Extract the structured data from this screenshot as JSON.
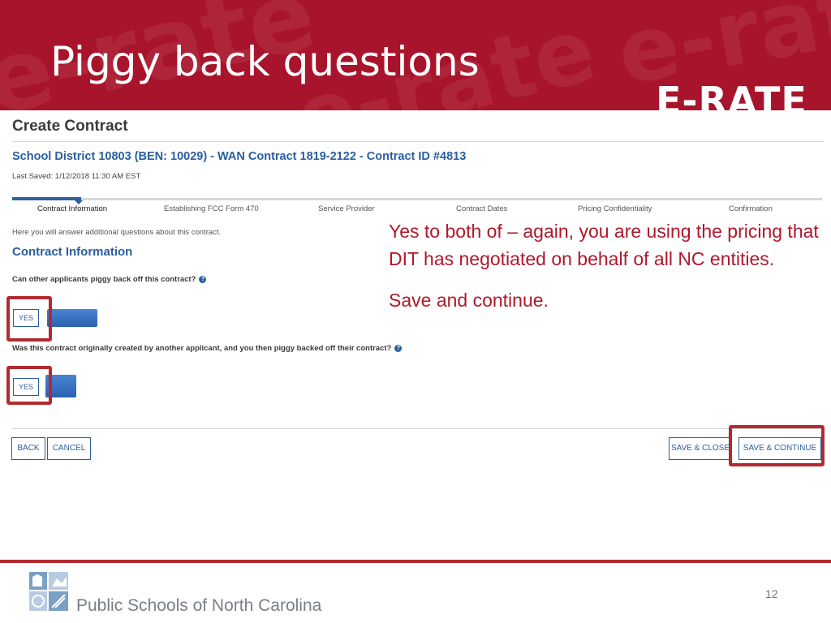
{
  "slide": {
    "title": "Piggy back questions",
    "logo_text": "E-RATE",
    "page_number": "12"
  },
  "screenshot": {
    "heading": "Create Contract",
    "contract_line": "School District 10803 (BEN: 10029) - WAN Contract 1819-2122 - Contract ID #4813",
    "last_saved": "Last Saved: 1/12/2018 11:30 AM EST",
    "steps": [
      {
        "label": "Contract Information",
        "active": true
      },
      {
        "label": "Establishing FCC Form 470",
        "active": false
      },
      {
        "label": "Service Provider",
        "active": false
      },
      {
        "label": "Contract Dates",
        "active": false
      },
      {
        "label": "Pricing Confidentiality",
        "active": false
      },
      {
        "label": "Confirmation",
        "active": false
      }
    ],
    "intro": "Here you will answer additional questions about this contract.",
    "section_title": "Contract Information",
    "question1": "Can other applicants piggy back off this contract?",
    "answer1": "YES",
    "question2": "Was this contract originally created by another applicant, and you then piggy backed off their contract?",
    "answer2": "YES",
    "buttons": {
      "back": "BACK",
      "cancel": "CANCEL",
      "save_close": "SAVE & CLOSE",
      "save_continue": "SAVE & CONTINUE"
    }
  },
  "callout": {
    "line1": "Yes to both of – again, you are using the pricing that DIT has negotiated on behalf of all NC entities.",
    "line2": "Save and continue."
  },
  "footer": {
    "org": "Public Schools of North Carolina"
  },
  "colors": {
    "banner": "#a8142b",
    "link_blue": "#2a5f9e",
    "highlight": "#b22a2f",
    "callout_text": "#b0182b"
  }
}
